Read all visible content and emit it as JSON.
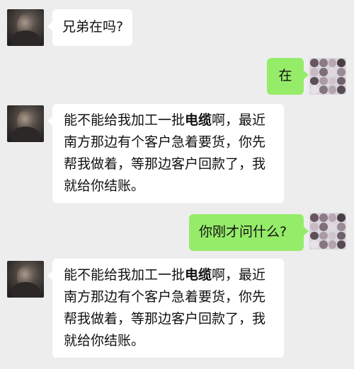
{
  "chat": {
    "messages": [
      {
        "side": "left",
        "lines": [
          "兄弟在吗?"
        ]
      },
      {
        "side": "right",
        "lines": [
          "在"
        ]
      },
      {
        "side": "left",
        "lines_parts": [
          [
            {
              "t": "能不能给我加工一批"
            },
            {
              "t": "电缆",
              "bold": true
            },
            {
              "t": "啊，最近"
            }
          ],
          [
            {
              "t": "南方那边有个客户急着要货，你先"
            }
          ],
          [
            {
              "t": "帮我做着，等那边客户回款了，我"
            }
          ],
          [
            {
              "t": "就给你结账。"
            }
          ]
        ]
      },
      {
        "side": "right",
        "lines": [
          "你刚才问什么?"
        ]
      },
      {
        "side": "left",
        "lines_parts": [
          [
            {
              "t": "能不能给我加工一批"
            },
            {
              "t": "电缆",
              "bold": true
            },
            {
              "t": "啊，最近"
            }
          ],
          [
            {
              "t": "南方那边有个客户急着要货，你先"
            }
          ],
          [
            {
              "t": "帮我做着，等那边客户回款了，我"
            }
          ],
          [
            {
              "t": "就给你结账。"
            }
          ]
        ]
      }
    ]
  },
  "colors": {
    "background": "#ededed",
    "bubble_left": "#ffffff",
    "bubble_right": "#95ec69"
  }
}
